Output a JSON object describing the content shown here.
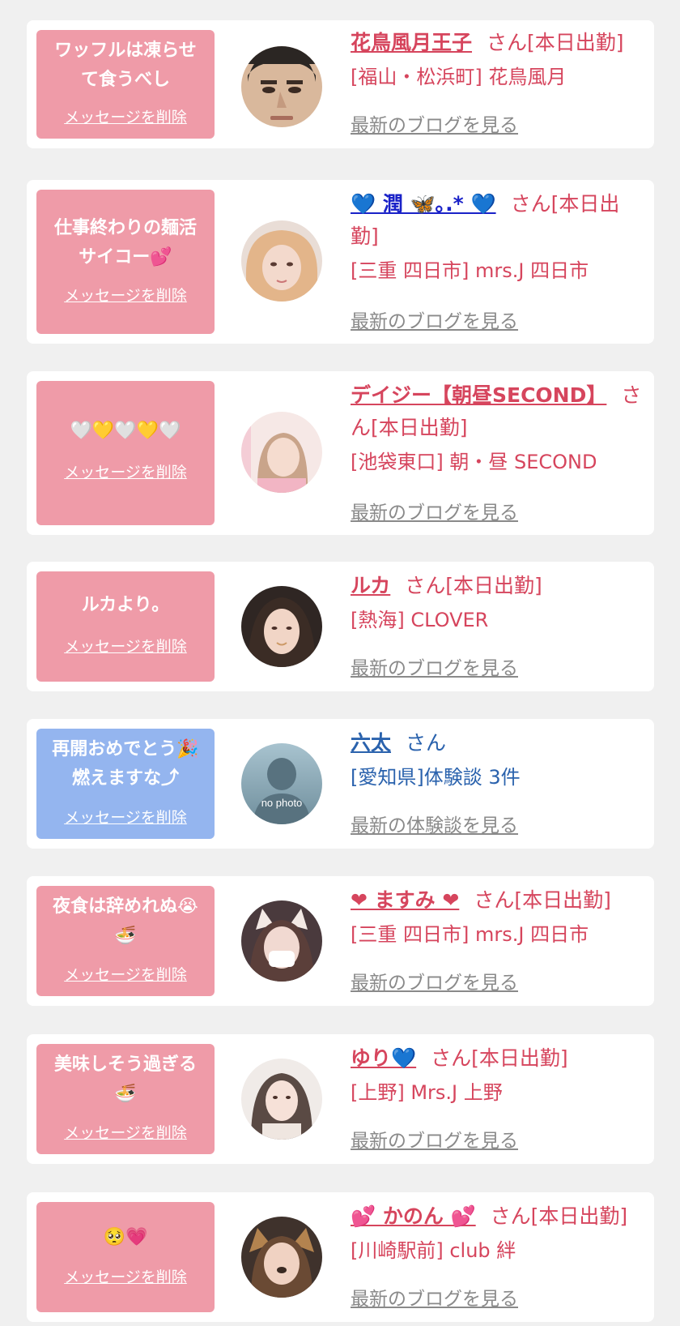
{
  "items": [
    {
      "message": "ワッフルは凍らせ\nて食うべし",
      "delete_label": "メッセージを削除",
      "avatar_icon": "man-photo-avatar",
      "name": "花鳥風月王子",
      "suffix": "さん[本日出勤]",
      "shop": "[福山・松浜町] 花鳥風月",
      "link": "最新のブログを見る",
      "theme": "pink"
    },
    {
      "message": "仕事終わりの麺活\nサイコー💕",
      "delete_label": "メッセージを削除",
      "avatar_icon": "woman-photo-avatar",
      "name": "💙 潤 🦋｡.* 💙",
      "suffix": "さん[本日出勤]",
      "shop": "[三重 四日市] mrs.J 四日市",
      "link": "最新のブログを見る",
      "theme": "pink"
    },
    {
      "message": "🤍💛🤍💛🤍",
      "delete_label": "メッセージを削除",
      "avatar_icon": "woman-photo-avatar",
      "name": "デイジー【朝昼SECOND】",
      "suffix": "さん[本日出勤]",
      "shop": "[池袋東口] 朝・昼 SECOND",
      "link": "最新のブログを見る",
      "theme": "pink"
    },
    {
      "message": "ルカより。",
      "delete_label": "メッセージを削除",
      "avatar_icon": "woman-photo-avatar",
      "name": "ルカ",
      "suffix": "さん[本日出勤]",
      "shop": "[熱海] CLOVER",
      "link": "最新のブログを見る",
      "theme": "pink"
    },
    {
      "message": "再開おめでとう🎉\n燃えますな⤴",
      "delete_label": "メッセージを削除",
      "avatar_icon": "no-photo-avatar",
      "avatar_text": "no photo",
      "name": "六太",
      "suffix": "さん",
      "shop": "[愛知県]体験談 3件",
      "link": "最新の体験談を見る",
      "theme": "blue"
    },
    {
      "message": "夜食は辞めれぬ😭\n🍜",
      "delete_label": "メッセージを削除",
      "avatar_icon": "woman-photo-avatar",
      "name": "❤ ますみ ❤",
      "suffix": "さん[本日出勤]",
      "shop": "[三重 四日市] mrs.J 四日市",
      "link": "最新のブログを見る",
      "theme": "pink"
    },
    {
      "message": "美味しそう過ぎる\n🍜",
      "delete_label": "メッセージを削除",
      "avatar_icon": "woman-photo-avatar",
      "name": "ゆり💙",
      "suffix": "さん[本日出勤]",
      "shop": "[上野] Mrs.J 上野",
      "link": "最新のブログを見る",
      "theme": "pink"
    },
    {
      "message": "🥺💗",
      "delete_label": "メッセージを削除",
      "avatar_icon": "woman-photo-avatar",
      "name": "💕 かのん 💕",
      "suffix": "さん[本日出勤]",
      "shop": "[川崎駅前] club 絆",
      "link": "最新のブログを見る",
      "theme": "pink"
    }
  ],
  "colors": {
    "background": "#f0f0f0",
    "card": "#ffffff",
    "bubble_pink": "#ef9ba8",
    "bubble_blue": "#94b5ef",
    "name_pink": "#d6455d",
    "name_blue": "#2a62ad",
    "link_gray": "#8a8a8a"
  }
}
